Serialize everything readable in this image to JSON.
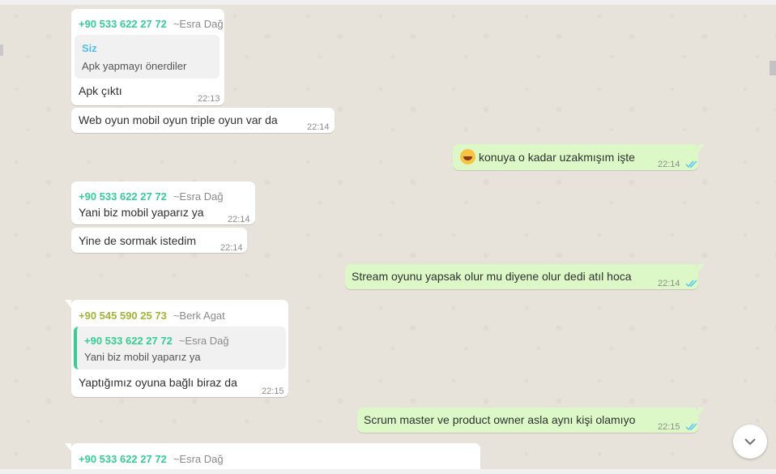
{
  "colors": {
    "background": "#e7e2da",
    "incoming_bubble": "#ffffff",
    "outgoing_bubble": "#dcf8c6",
    "sender_green": "#35cd96",
    "sender_olive": "#a5b337",
    "read_ticks": "#4fc3f7"
  },
  "messages": {
    "m1": {
      "sender_phone": "+90 533 622 27 72",
      "sender_name": "~Esra Dağ",
      "quote_name": "Siz",
      "quote_text": "Apk yapmayı önerdiler",
      "text": "Apk çıktı",
      "time": "22:13"
    },
    "m2": {
      "text": "Web oyun mobil oyun triple oyun var da",
      "time": "22:14"
    },
    "m3": {
      "text": "konuya o kadar uzakmışım işte",
      "time": "22:14",
      "emoji": "grinning-face-emoji",
      "status_icon": "double-check-icon"
    },
    "m4": {
      "sender_phone": "+90 533 622 27 72",
      "sender_name": "~Esra Dağ",
      "text": "Yani biz mobil yaparız ya",
      "time": "22:14"
    },
    "m5": {
      "text": "Yine de sormak istedim",
      "time": "22:14"
    },
    "m6": {
      "text": "Stream oyunu yapsak olur mu diyene olur dedi atıl hoca",
      "time": "22:14",
      "status_icon": "double-check-icon"
    },
    "m7": {
      "sender_phone": "+90 545 590 25 73",
      "sender_name": "~Berk Agat",
      "quote_phone": "+90 533 622 27 72",
      "quote_name": "~Esra Dağ",
      "quote_text": "Yani biz mobil yaparız ya",
      "text": "Yaptığımız oyuna bağlı biraz da",
      "time": "22:15"
    },
    "m8": {
      "text": "Scrum master ve product owner asla aynı kişi olamıyo",
      "time": "22:15",
      "status_icon": "double-check-icon"
    },
    "m9": {
      "sender_phone": "+90 533 622 27 72",
      "sender_name": "~Esra Dağ"
    }
  },
  "scroll_button": {
    "icon": "chevron-down-icon"
  }
}
